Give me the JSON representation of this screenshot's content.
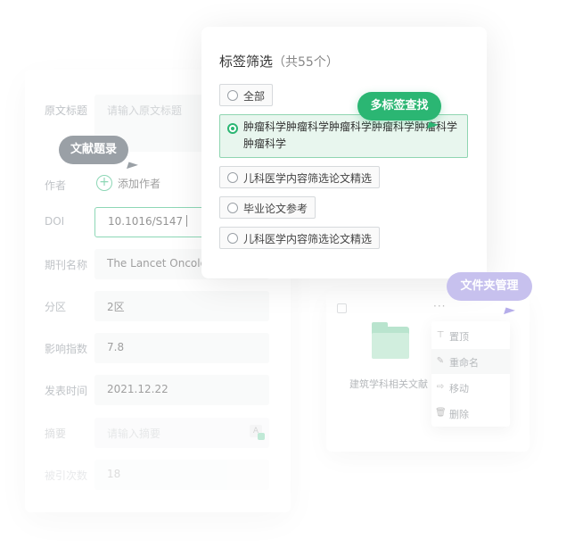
{
  "form": {
    "rows": [
      {
        "label": "原文标题",
        "placeholder": "请输入原文标题"
      },
      {
        "label": "作者",
        "add_author": "添加作者"
      },
      {
        "label": "DOI",
        "value": "10.1016/S147"
      },
      {
        "label": "期刊名称",
        "value": "The Lancet Oncolo"
      },
      {
        "label": "分区",
        "value": "2区"
      },
      {
        "label": "影响指数",
        "value": "7.8"
      },
      {
        "label": "发表时间",
        "value": "2021.12.22"
      },
      {
        "label": "摘要",
        "placeholder": "请输入摘要"
      },
      {
        "label": "被引次数",
        "value": "18"
      }
    ],
    "translate_icon": "A"
  },
  "tag_filter": {
    "title": "标签筛选",
    "count": "（共55个）",
    "options": [
      {
        "label": "全部",
        "selected": false
      },
      {
        "label": "肿瘤科学肿瘤科学肿瘤科学肿瘤科学肿瘤科学肿瘤科学",
        "selected": true
      },
      {
        "label": "儿科医学内容筛选论文精选",
        "selected": false
      },
      {
        "label": "毕业论文参考",
        "selected": false
      },
      {
        "label": "儿科医学内容筛选论文精选",
        "selected": false
      }
    ]
  },
  "folder": {
    "more": "···",
    "name": "建筑学科相关文献",
    "menu": [
      {
        "label": "置顶",
        "icon": "⊤"
      },
      {
        "label": "重命名",
        "icon": "✎"
      },
      {
        "label": "移动",
        "icon": "⇨"
      },
      {
        "label": "删除",
        "icon": "🗑"
      }
    ]
  },
  "callouts": {
    "literature": "文献题录",
    "multi_tag": "多标签查找",
    "folder_manage": "文件夹管理"
  },
  "colors": {
    "accent": "#2bb673",
    "callout_gray": "#9aa0a6",
    "callout_purple": "#c7c1ee"
  }
}
